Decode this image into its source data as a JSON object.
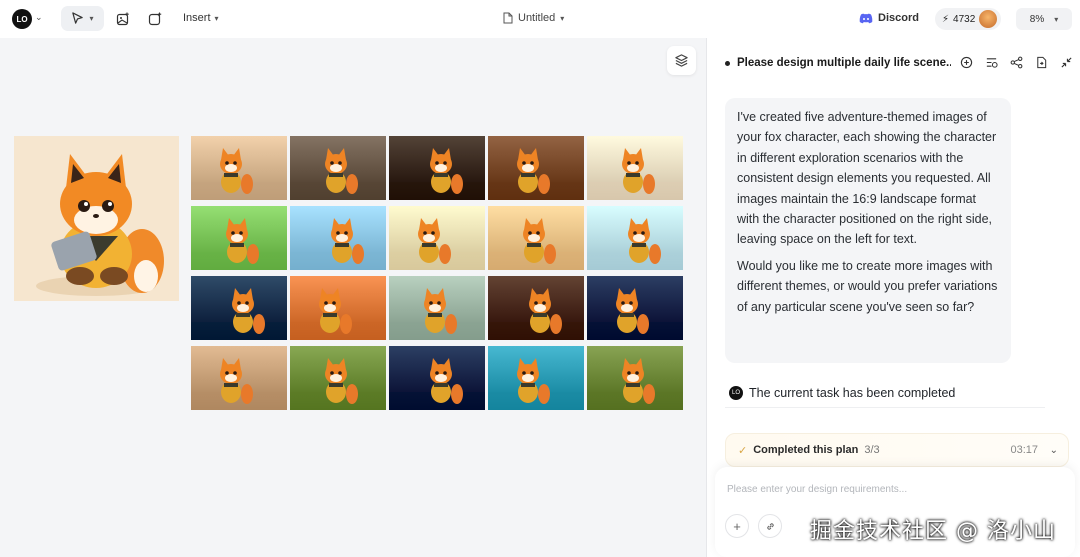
{
  "toolbar": {
    "insert_label": "Insert",
    "doc_title": "Untitled",
    "discord_label": "Discord",
    "credits": "4732",
    "zoom": "8%"
  },
  "panel": {
    "title": "Please design multiple daily life scene...",
    "message_p1": "I've created five adventure-themed images of your fox character, each showing the character in different exploration scenarios with the consistent design elements you requested. All images maintain the 16:9 landscape format with the character positioned on the right side, leaving space on the left for text.",
    "message_p2": "Would you like me to create more images with different themes, or would you prefer variations of any particular scene you've seen so far?",
    "status": "The current task has been completed",
    "plan_label": "Completed this plan",
    "plan_count": "3/3",
    "plan_time": "03:17",
    "input_placeholder": "Please enter your design requirements...",
    "watermark": "掘金技术社区 @ 洛小山"
  },
  "canvas": {
    "scenes": [
      [
        "#d9b892",
        "#6b5a4a",
        "#3a2a1e",
        "#7a4a2a",
        "#f1e1c6"
      ],
      [
        "#7cc65a",
        "#8fc9e8",
        "#f2e2b6",
        "#f0c58a",
        "#bfe4ef"
      ],
      [
        "#16324f",
        "#e07a3a",
        "#9fb7a6",
        "#4a2a1a",
        "#13254a"
      ],
      [
        "#c9a27a",
        "#6f8f3a",
        "#13264a",
        "#2e9fb8",
        "#6f8a3a"
      ]
    ]
  }
}
